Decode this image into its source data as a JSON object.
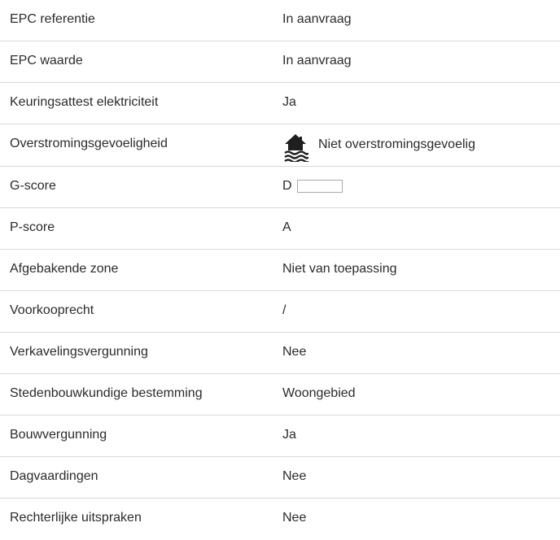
{
  "rows": [
    {
      "label": "EPC referentie",
      "value": "In aanvraag"
    },
    {
      "label": "EPC waarde",
      "value": "In aanvraag"
    },
    {
      "label": "Keuringsattest elektriciteit",
      "value": "Ja"
    },
    {
      "label": "Overstromingsgevoeligheid",
      "value": "Niet overstromingsgevoelig",
      "icon": "house-flood-icon"
    },
    {
      "label": "G-score",
      "value": "D"
    },
    {
      "label": "P-score",
      "value": "A"
    },
    {
      "label": "Afgebakende zone",
      "value": "Niet van toepassing"
    },
    {
      "label": "Voorkooprecht",
      "value": "/"
    },
    {
      "label": "Verkavelingsvergunning",
      "value": "Nee"
    },
    {
      "label": "Stedenbouwkundige bestemming",
      "value": "Woongebied"
    },
    {
      "label": "Bouwvergunning",
      "value": "Ja"
    },
    {
      "label": "Dagvaardingen",
      "value": "Nee"
    },
    {
      "label": "Rechterlijke uitspraken",
      "value": "Nee"
    }
  ],
  "colors": {
    "text": "#2b2b2b",
    "divider": "#d9d9d9",
    "icon": "#1f1f1f"
  }
}
